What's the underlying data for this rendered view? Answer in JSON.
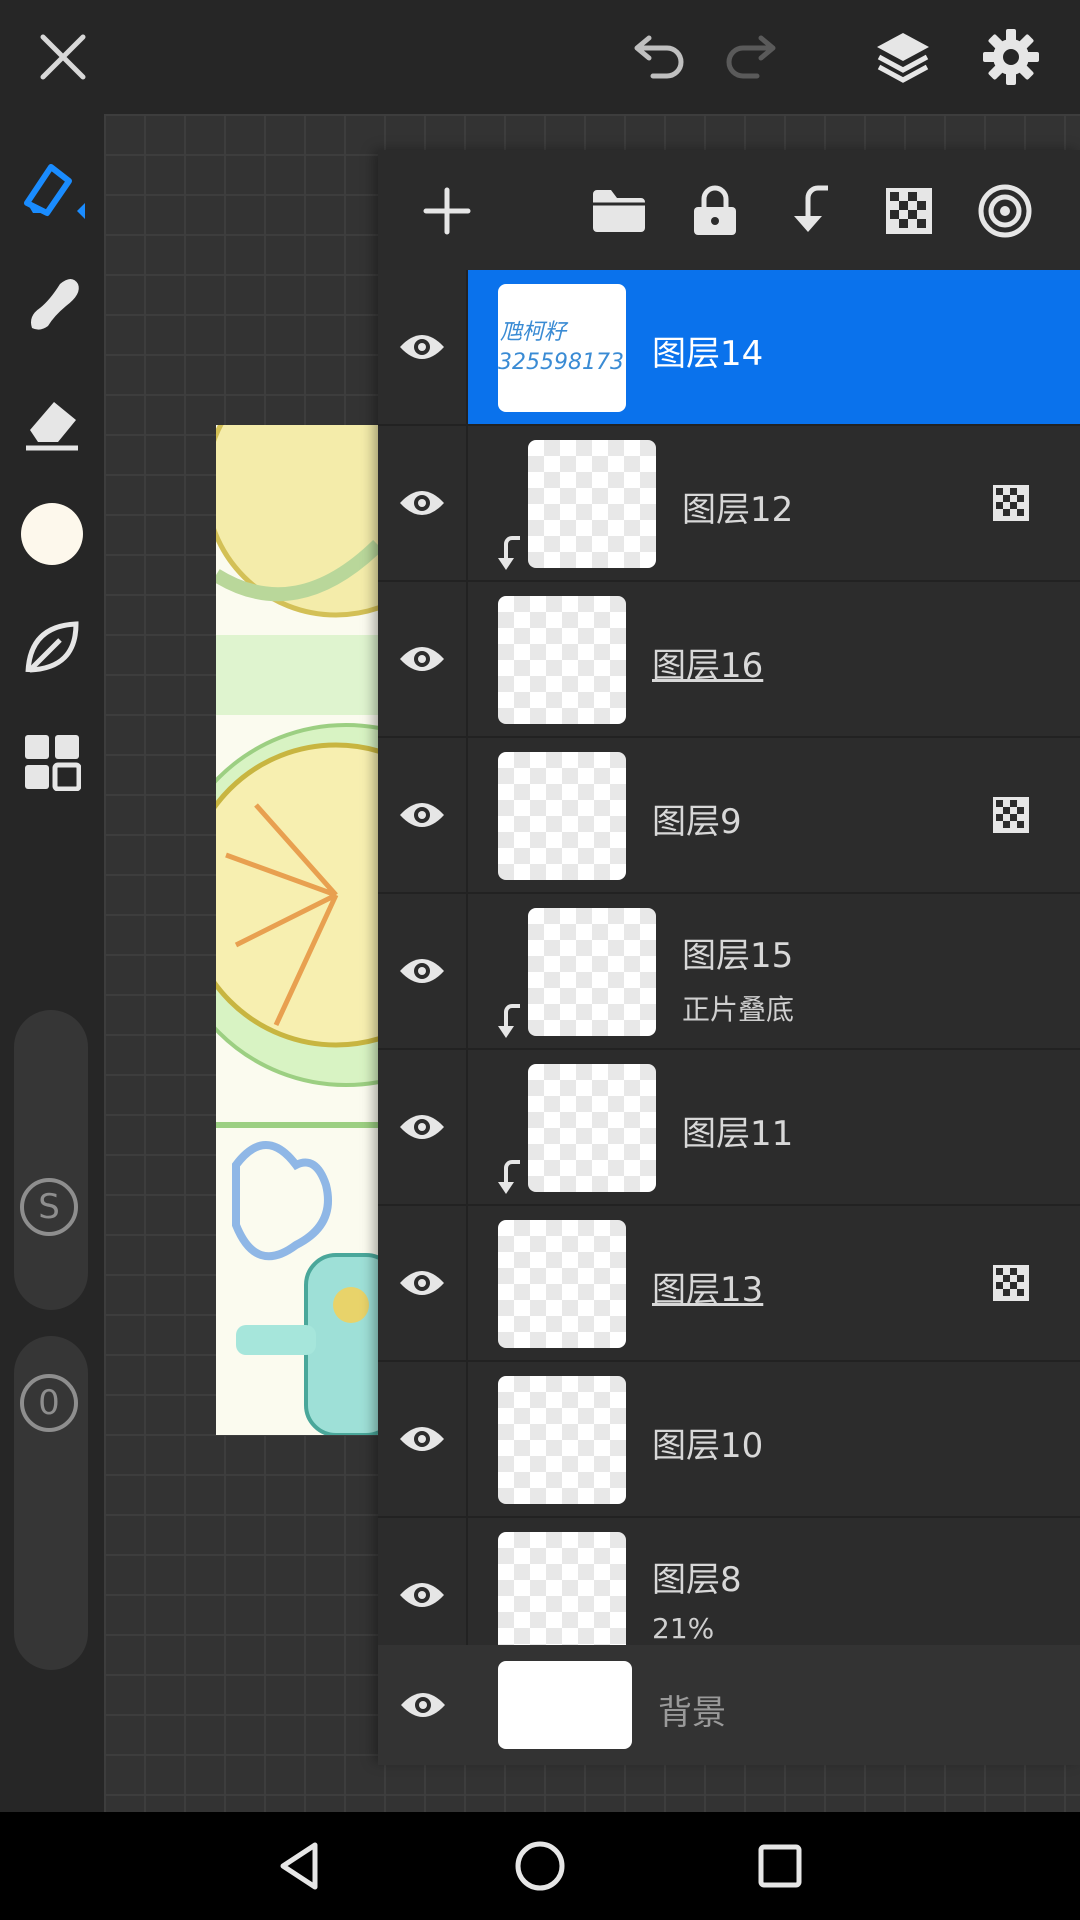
{
  "colors": {
    "accent": "#0a72ec",
    "toolbar_bg": "#262626",
    "panel_bg": "#2c2c2c",
    "brush_color": "#fdf8ec"
  },
  "topbar": {
    "close_icon": "close-icon",
    "undo_icon": "undo-icon",
    "redo_icon": "redo-icon",
    "layers_icon": "layers-icon",
    "settings_icon": "gear-icon"
  },
  "left_tools": [
    "brush-icon",
    "smudge-icon",
    "eraser-icon",
    "color-swatch",
    "leaf-icon",
    "grid-icon"
  ],
  "sliders": {
    "size_label": "S",
    "opacity_label": "0"
  },
  "panel_toolbar": [
    "add-icon",
    "folder-icon",
    "lock-icon",
    "merge-down-icon",
    "alpha-lock-icon",
    "target-icon"
  ],
  "layers": [
    {
      "name": "图层14",
      "active": true,
      "thumb_text_1": "虺柯籽",
      "thumb_text_2": "325598173"
    },
    {
      "name": "图层12",
      "clipped": true,
      "alpha_locked": true
    },
    {
      "name": "图层16",
      "underlined": true
    },
    {
      "name": "图层9",
      "alpha_locked": true
    },
    {
      "name": "图层15",
      "clipped": true,
      "sub": "正片叠底"
    },
    {
      "name": "图层11",
      "clipped": true
    },
    {
      "name": "图层13",
      "underlined": true,
      "alpha_locked": true
    },
    {
      "name": "图层10"
    },
    {
      "name": "图层8",
      "sub": "21%"
    }
  ],
  "background_layer": {
    "name": "背景"
  },
  "navbar": [
    "back-icon",
    "home-icon",
    "recents-icon"
  ]
}
